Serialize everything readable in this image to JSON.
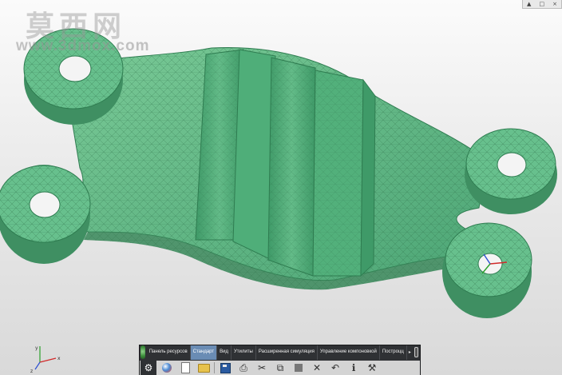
{
  "watermark": {
    "title": "莫西网",
    "url": "www.3dmox.com"
  },
  "window_controls": {
    "scroll_up": "▲",
    "restore": "□",
    "close": "×"
  },
  "ribbon": {
    "tabs": [
      {
        "label": "Панель ресурсов",
        "active": false
      },
      {
        "label": "Стандарт",
        "active": true
      },
      {
        "label": "Вид",
        "active": false
      },
      {
        "label": "Утилиты",
        "active": false
      },
      {
        "label": "Расширенная симуляция",
        "active": false
      },
      {
        "label": "Управление компоновкой",
        "active": false
      },
      {
        "label": "Построцц",
        "active": false
      }
    ],
    "more_arrow": "▸",
    "tools": [
      {
        "name": "settings-gear-icon",
        "glyph": "⚙"
      },
      {
        "name": "new-file-icon",
        "glyph": ""
      },
      {
        "name": "open-folder-icon",
        "glyph": ""
      },
      {
        "name": "save-disk-icon",
        "glyph": ""
      },
      {
        "name": "print-icon",
        "glyph": "⎙"
      },
      {
        "name": "cut-icon",
        "glyph": "✂"
      },
      {
        "name": "copy-icon",
        "glyph": "⧉"
      },
      {
        "name": "paste-icon",
        "glyph": ""
      },
      {
        "name": "delete-icon",
        "glyph": "✕"
      },
      {
        "name": "undo-icon",
        "glyph": "↶"
      },
      {
        "name": "info-icon",
        "glyph": "ℹ"
      },
      {
        "name": "tools-icon",
        "glyph": "⚒"
      }
    ]
  },
  "colors": {
    "part_fill": "#5fb985",
    "part_dark": "#3f8f62",
    "mesh_line": "#2d6d47",
    "ribbon_bg": "#2f3134",
    "tab_active": "#6a8cb4"
  }
}
